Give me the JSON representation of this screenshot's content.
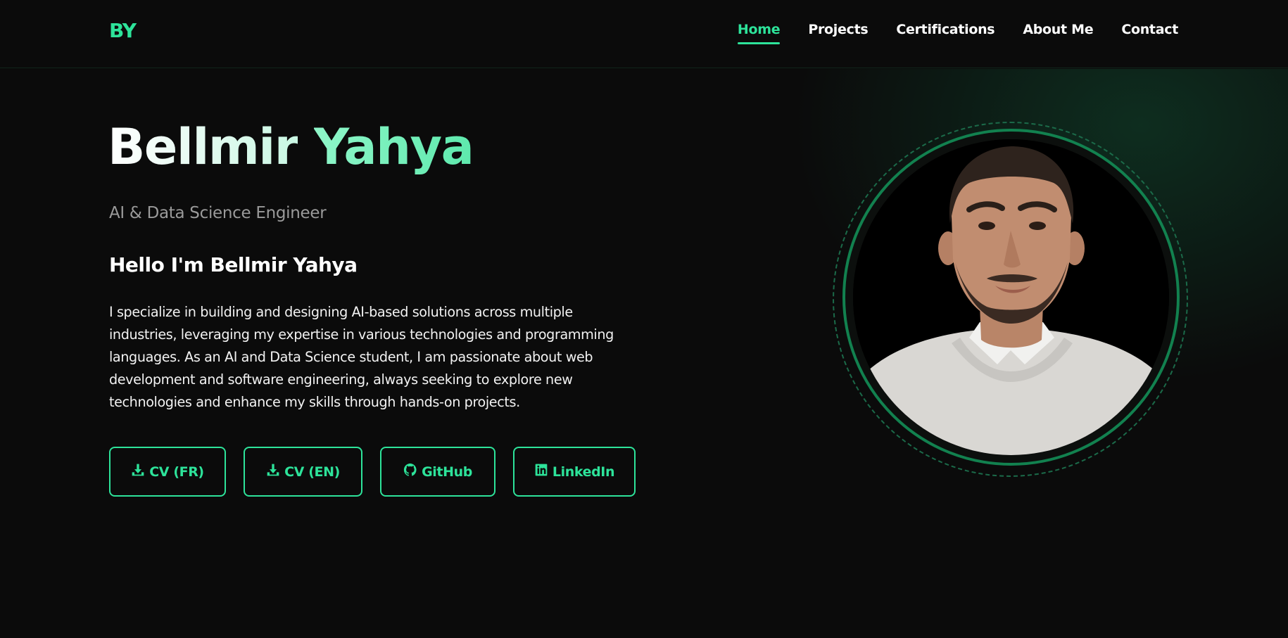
{
  "logo": "BY",
  "nav": {
    "items": [
      {
        "label": "Home",
        "active": true
      },
      {
        "label": "Projects",
        "active": false
      },
      {
        "label": "Certifications",
        "active": false
      },
      {
        "label": "About Me",
        "active": false
      },
      {
        "label": "Contact",
        "active": false
      }
    ]
  },
  "hero": {
    "name_first": "Bellmir",
    "name_last": "Yahya",
    "subtitle": "AI & Data Science Engineer",
    "greeting": "Hello I'm Bellmir Yahya",
    "bio": "I specialize in building and designing AI-based solutions across multiple industries, leveraging my expertise in various technologies and programming languages. As an AI and Data Science student, I am passionate about web development and software engineering, always seeking to explore new technologies and enhance my skills through hands-on projects.",
    "buttons": [
      {
        "label": "CV (FR)",
        "icon": "download-icon"
      },
      {
        "label": "CV (EN)",
        "icon": "download-icon"
      },
      {
        "label": "GitHub",
        "icon": "github-icon"
      },
      {
        "label": "LinkedIn",
        "icon": "linkedin-icon"
      }
    ]
  },
  "colors": {
    "accent": "#2de39a",
    "background": "#0b0b0b",
    "ring": "#12814f"
  }
}
